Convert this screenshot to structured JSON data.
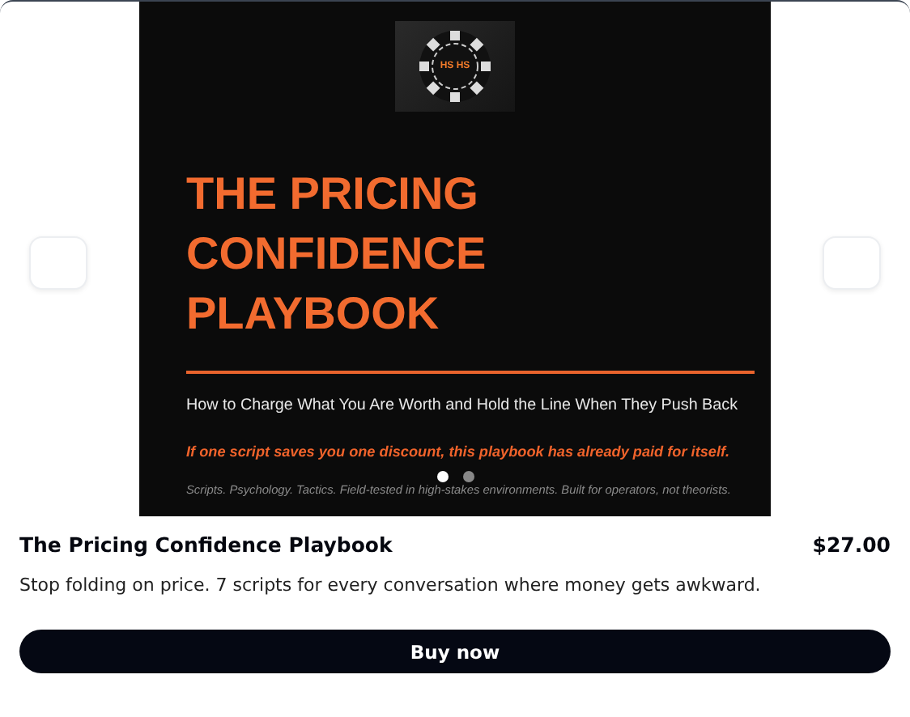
{
  "cover": {
    "logo_text": "HS HS",
    "headline": [
      "THE PRICING",
      "CONFIDENCE",
      "PLAYBOOK"
    ],
    "subtitle": "How to Charge What You Are Worth and Hold the Line When They Push Back",
    "hook": "If one script saves you one discount, this playbook has already paid for itself.",
    "footnote": "Scripts. Psychology. Tactics. Field-tested in high-stakes environments. Built for operators, not theorists."
  },
  "carousel": {
    "dots": [
      {
        "selected": true
      },
      {
        "selected": false
      }
    ]
  },
  "product": {
    "title": "The Pricing Confidence Playbook",
    "price": "$27.00",
    "description": "Stop folding on price. 7 scripts for every conversation where money gets awkward."
  },
  "buy_button": "Buy now"
}
